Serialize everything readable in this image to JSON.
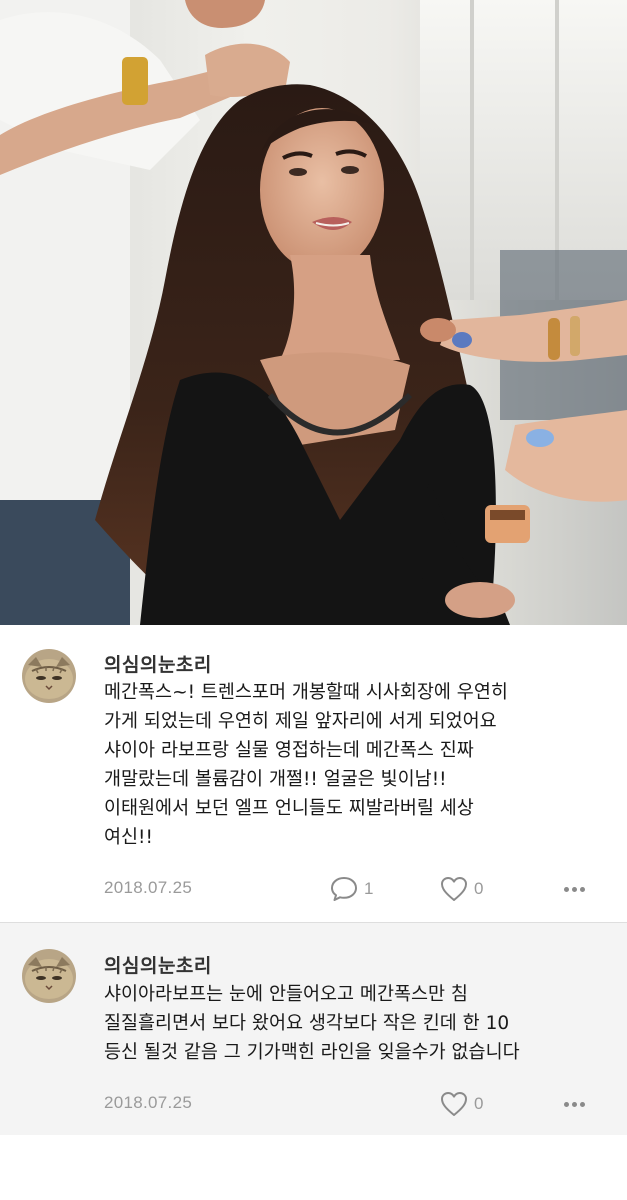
{
  "photo": {
    "alt_icon": "photo-image"
  },
  "comments": [
    {
      "author": "의심의눈초리",
      "text": "메간폭스~! 트렌스포머 개봉할때 시사회장에 우연히\n가게 되었는데 우연히 제일 앞자리에 서게 되었어요\n샤이아 라보프랑 실물 영접하는데 메간폭스 진짜\n개말랐는데 볼륨감이 개쩔!! 얼굴은 빛이남!!\n이태원에서 보던 엘프 언니들도 찌발라버릴 세상\n여신!!",
      "date": "2018.07.25",
      "reply_count": "1",
      "like_count": "0"
    },
    {
      "author": "의심의눈초리",
      "text": "샤이아라보프는 눈에 안들어오고 메간폭스만 침\n질질흘리면서 보다 왔어요 생각보다 작은 킨데 한 10\n등신 될것 같음 그 기가맥힌 라인을 잊을수가 없습니다",
      "date": "2018.07.25",
      "like_count": "0"
    }
  ],
  "colors": {
    "meta_gray": "#9a9a9a",
    "second_bg": "#f4f4f4",
    "divider": "#dedede"
  }
}
